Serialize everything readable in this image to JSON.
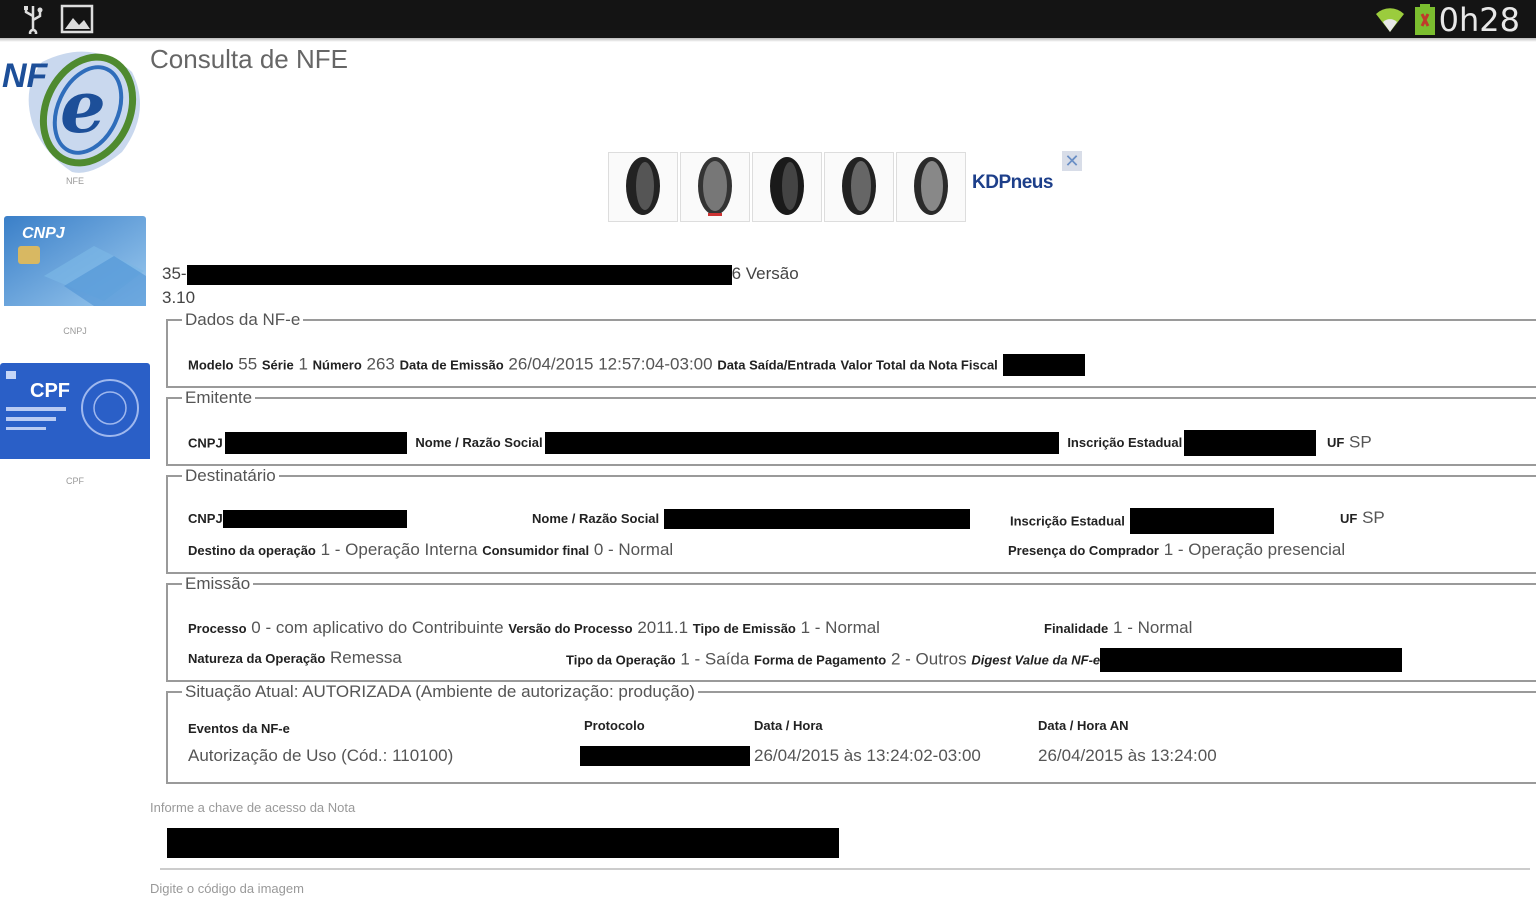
{
  "statusbar": {
    "clock": "0h28"
  },
  "app": {
    "title": "Consulta de NFE",
    "sidebar": [
      {
        "caption": "NFE"
      },
      {
        "caption": "CNPJ",
        "card_text": "CNPJ"
      },
      {
        "caption": "CPF",
        "card_text": "CPF"
      }
    ],
    "logo_text": "NF"
  },
  "ad": {
    "brand": "KDPneus",
    "close": "✕"
  },
  "chave": {
    "prefix": "35-",
    "suffix": "6 Versão",
    "versao": "3.10"
  },
  "dados": {
    "legend": "Dados da NF-e",
    "modelo_lbl": "Modelo",
    "modelo": "55",
    "serie_lbl": "Série",
    "serie": "1",
    "numero_lbl": "Número",
    "numero": "263",
    "emissao_lbl": "Data de Emissão",
    "emissao": "26/04/2015 12:57:04-03:00",
    "saida_lbl": "Data Saída/Entrada",
    "valor_lbl": "Valor Total da Nota Fiscal"
  },
  "emitente": {
    "legend": "Emitente",
    "cnpj_lbl": "CNPJ",
    "nome_lbl": "Nome / Razão Social",
    "ie_lbl": "Inscrição Estadual",
    "uf_lbl": "UF",
    "uf": "SP"
  },
  "destinatario": {
    "legend": "Destinatário",
    "cnpj_lbl": "CNPJ",
    "nome_lbl": "Nome / Razão Social",
    "ie_lbl": "Inscrição Estadual",
    "uf_lbl": "UF",
    "uf": "SP",
    "destino_lbl": "Destino da operação",
    "destino": "1 - Operação Interna",
    "consumidor_lbl": "Consumidor final",
    "consumidor": "0 - Normal",
    "presenca_lbl": "Presença do Comprador",
    "presenca": "1 - Operação presencial"
  },
  "emissao": {
    "legend": "Emissão",
    "processo_lbl": "Processo",
    "processo": "0 - com aplicativo do Contribuinte",
    "versao_lbl": "Versão do Processo",
    "versao": "2011.1",
    "tipo_emissao_lbl": "Tipo de Emissão",
    "tipo_emissao": "1 - Normal",
    "finalidade_lbl": "Finalidade",
    "finalidade": "1 - Normal",
    "natureza_lbl": "Natureza da Operação",
    "natureza": "Remessa",
    "tipo_op_lbl": "Tipo da Operação",
    "tipo_op": "1 - Saída",
    "forma_pag_lbl": "Forma de Pagamento",
    "forma_pag": "2 - Outros",
    "digest_lbl": "Digest Value da NF-e"
  },
  "situacao": {
    "legend": "Situação Atual:  AUTORIZADA (Ambiente de autorização: produção)",
    "eventos_lbl": "Eventos da NF-e",
    "protocolo_lbl": "Protocolo",
    "data_hora_lbl": "Data / Hora",
    "data_hora_an_lbl": "Data / Hora AN",
    "evento": "Autorização de Uso (Cód.: 110100)",
    "data_hora": "26/04/2015 às 13:24:02-03:00",
    "data_hora_an": "26/04/2015 às 13:24:00"
  },
  "form": {
    "chave_label": "Informe a chave de acesso da Nota",
    "codigo_label": "Digite o código da imagem"
  }
}
